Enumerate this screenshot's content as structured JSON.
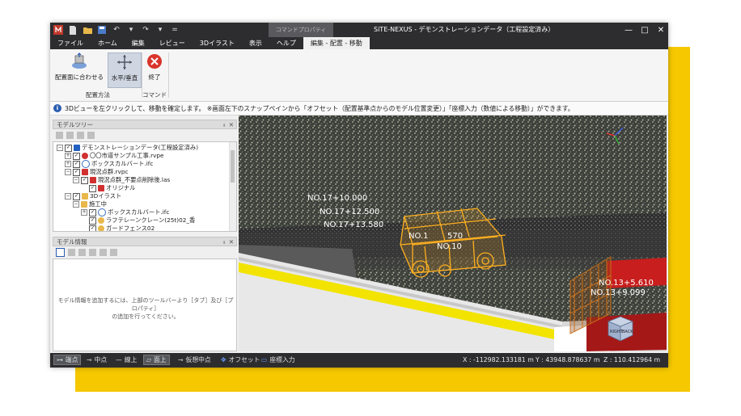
{
  "app": {
    "title": "SiTE-NEXUS - デモンストレーションデータ（工程設定済み）",
    "context_tab_header": "コマンドプロパティ"
  },
  "ribbon": {
    "tabs": [
      {
        "label": "ファイル"
      },
      {
        "label": "ホーム"
      },
      {
        "label": "編集"
      },
      {
        "label": "レビュー"
      },
      {
        "label": "3Dイラスト"
      },
      {
        "label": "表示"
      },
      {
        "label": "ヘルプ"
      },
      {
        "label": "編集 - 配置 - 移動"
      }
    ],
    "active_tab": 7,
    "buttons": {
      "fit_surface": "配置面に合わせる",
      "horizontal_vertical": "水平/垂直",
      "exit": "終了"
    },
    "groups": {
      "placement": "配置方法",
      "command": "コマンド"
    }
  },
  "infobar": {
    "message": "3Dビューを左クリックして、移動を確定します。 ※画面左下のスナップペインから「オフセット（配置基準点からのモデル位置変更）」「座標入力（数値による移動）」ができます。"
  },
  "model_tree": {
    "title": "モデルツリー",
    "items": [
      {
        "label": "デモンストレーションデータ(工程設定済み)",
        "level": 0,
        "expanded": true,
        "icon": "project-icon",
        "color": "#2060c0"
      },
      {
        "label": "〇〇市道サンプル工事.rvpe",
        "level": 1,
        "expanded": false,
        "icon": "rvpe-icon",
        "color": "#d03030"
      },
      {
        "label": "ボックスカルバート.ifc",
        "level": 1,
        "expanded": false,
        "icon": "ifc-icon",
        "color": "#3a6fc0"
      },
      {
        "label": "現況点群.rvpc",
        "level": 1,
        "expanded": true,
        "icon": "pointcloud-icon",
        "color": "#d03030"
      },
      {
        "label": "現況点群_不要点削除後.las",
        "level": 2,
        "expanded": true,
        "icon": "las-icon",
        "color": "#d03030"
      },
      {
        "label": "オリジナル",
        "level": 3,
        "expanded": null,
        "icon": "cube-icon",
        "color": "#d03030"
      },
      {
        "label": "3Dイラスト",
        "level": 1,
        "expanded": true,
        "icon": "folder-icon",
        "color": "#e8b84a"
      },
      {
        "label": "施工中",
        "level": 2,
        "expanded": true,
        "icon": "folder-icon",
        "color": "#e8b84a"
      },
      {
        "label": "ボックスカルバート.ifc",
        "level": 3,
        "expanded": false,
        "icon": "ifc-icon",
        "color": "#3a6fc0"
      },
      {
        "label": "ラフテレーンクレーン(25t)02_香",
        "level": 3,
        "expanded": null,
        "icon": "model-icon",
        "color": "#e8b84a"
      },
      {
        "label": "ガードフェンス02",
        "level": 3,
        "expanded": null,
        "icon": "model-icon",
        "color": "#e8b84a"
      }
    ]
  },
  "model_info": {
    "title": "モデル情報",
    "hint_line1": "モデル情報を追加するには、上部のツールバーより［タブ］及び［プロパティ］",
    "hint_line2": "の追加を行ってください。"
  },
  "viewport": {
    "stations": [
      "NO.17+10.000",
      "NO.17+12.500",
      "NO.17+13.580",
      "NO.1",
      "570",
      "NO.10",
      "NO.13+5.610",
      "NO.13+9.099"
    ],
    "nav_cube": {
      "front": "RIGHT",
      "back": "BACK"
    },
    "colors": {
      "vehicle": "#ffb020",
      "road": "#3a3a3a",
      "curb_yellow": "#f2e400",
      "barrier_red": "#c81e1e"
    }
  },
  "statusbar": {
    "snaps": [
      {
        "label": "端点",
        "on": true,
        "icon": "endpoint-icon"
      },
      {
        "label": "中点",
        "on": false,
        "icon": "midpoint-icon"
      },
      {
        "label": "線上",
        "on": false,
        "icon": "online-icon"
      },
      {
        "label": "面上",
        "on": true,
        "icon": "onsurface-icon"
      },
      {
        "label": "仮想中点",
        "on": false,
        "icon": "virtual-midpoint-icon"
      },
      {
        "label": "オフセット",
        "on": false,
        "icon": "offset-icon"
      },
      {
        "label": "座標入力",
        "on": false,
        "icon": "coordinate-input-icon"
      }
    ],
    "x": "X : -112982.133181 m",
    "y": "Y : 43948.878637 m",
    "z": "Z : 110.412964 m"
  }
}
